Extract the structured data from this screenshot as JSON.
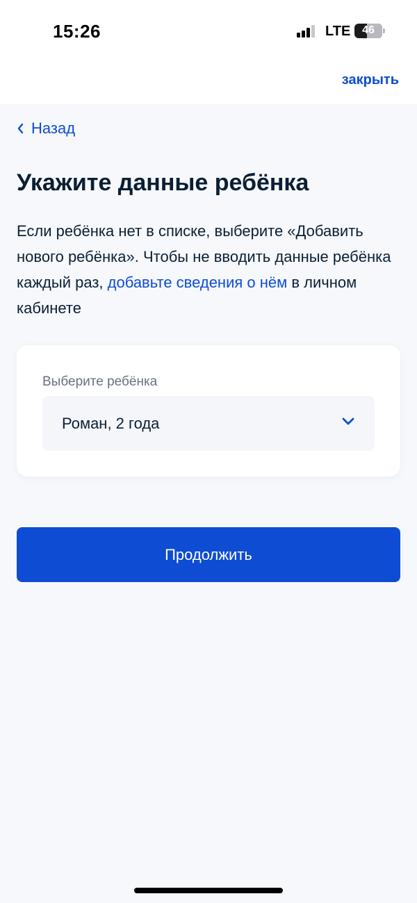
{
  "status_bar": {
    "time": "15:26",
    "network": "LTE",
    "battery": "46",
    "battery_level_percent": 46
  },
  "header": {
    "close_label": "закрыть"
  },
  "nav": {
    "back_label": "Назад",
    "back_icon": "chevron-left-icon"
  },
  "page": {
    "title": "Укажите данные ребёнка",
    "description_part1": "Если ребёнка нет в списке, выберите «Добавить нового ребёнка». Чтобы не вводить данные ребёнка каждый раз, ",
    "description_link": "добавьте сведения о нём",
    "description_part2": " в личном кабинете"
  },
  "child_select": {
    "label": "Выберите ребёнка",
    "value": "Роман, 2 года",
    "icon": "chevron-down-icon"
  },
  "actions": {
    "continue_label": "Продолжить"
  },
  "colors": {
    "accent": "#0d4cd3",
    "text": "#0b1f33",
    "muted": "#66727f",
    "background": "#f6f8fc"
  }
}
